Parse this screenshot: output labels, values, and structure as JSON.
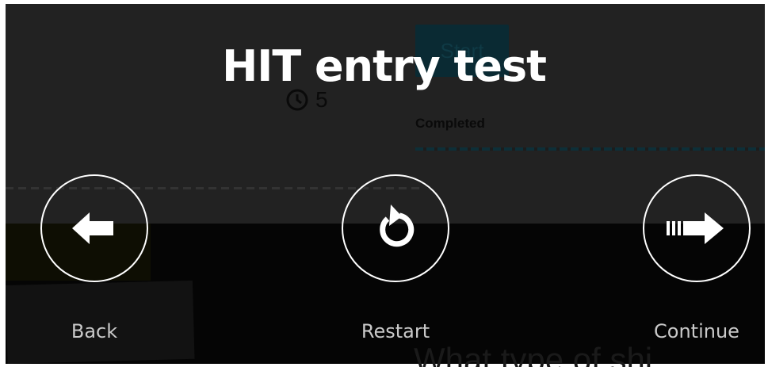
{
  "overlay": {
    "title": "HIT entry test",
    "back_label": "Back",
    "restart_label": "Restart",
    "continue_label": "Continue"
  },
  "background_page": {
    "start_button_label": "Start",
    "timer_value": "5",
    "completed_label": "Completed",
    "heading_partial": "What type of shi"
  },
  "icons": {
    "back": "arrow-left-icon",
    "restart": "restart-icon",
    "continue": "arrow-right-icon",
    "timer": "clock-icon"
  },
  "colors": {
    "overlay_text": "#ffffff",
    "label_text": "#c9c9c9",
    "accent_dim": "#0a2a33"
  }
}
